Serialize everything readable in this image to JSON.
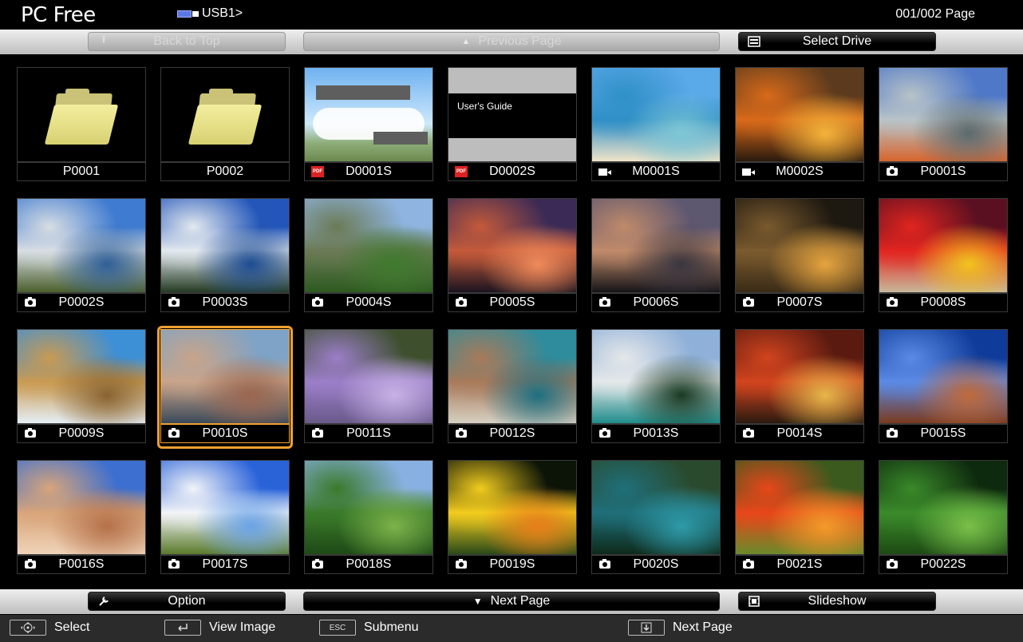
{
  "header": {
    "app_title": "PC Free",
    "drive_label": "USB1>",
    "page_indicator": "001/002 Page"
  },
  "top_bar": {
    "back_to_top": "Back to Top",
    "previous_page": "Previous Page",
    "select_drive": "Select Drive"
  },
  "bottom_bar": {
    "option": "Option",
    "next_page": "Next Page",
    "slideshow": "Slideshow"
  },
  "status_bar": {
    "select": "Select",
    "view_image": "View Image",
    "esc_key": "ESC",
    "submenu": "Submenu",
    "next_page": "Next Page"
  },
  "grid": {
    "items": [
      {
        "label": "P0001",
        "type": "folder"
      },
      {
        "label": "P0002",
        "type": "folder"
      },
      {
        "label": "D0001S",
        "type": "pdf",
        "thumb": "doc1"
      },
      {
        "label": "D0002S",
        "type": "pdf",
        "thumb": "doc2",
        "doc_title": "User's Guide"
      },
      {
        "label": "M0001S",
        "type": "movie",
        "colors": [
          "#5aa9e8",
          "#2f8fc7",
          "#7fc7d6",
          "#f1e4c8"
        ]
      },
      {
        "label": "M0002S",
        "type": "movie",
        "colors": [
          "#5b3a1d",
          "#d86a1a",
          "#f4b43a",
          "#2a1a0e"
        ]
      },
      {
        "label": "P0001S",
        "type": "photo",
        "colors": [
          "#4f78c8",
          "#b8c3c8",
          "#5b6a6e",
          "#d7652d"
        ]
      },
      {
        "label": "P0002S",
        "type": "photo",
        "colors": [
          "#3f7bd0",
          "#d8dde3",
          "#2f5f98",
          "#4b5f2c"
        ]
      },
      {
        "label": "P0003S",
        "type": "photo",
        "colors": [
          "#2356b8",
          "#e3e9ef",
          "#1d4c93",
          "#243a22"
        ]
      },
      {
        "label": "P0004S",
        "type": "photo",
        "colors": [
          "#8fb4e0",
          "#6b7a55",
          "#3f7a2e",
          "#2c5a1f"
        ]
      },
      {
        "label": "P0005S",
        "type": "photo",
        "colors": [
          "#3b2a55",
          "#c45a3a",
          "#f08a5a",
          "#1b1420"
        ]
      },
      {
        "label": "P0006S",
        "type": "photo",
        "colors": [
          "#5e5770",
          "#c08a6a",
          "#3a3640",
          "#151418"
        ]
      },
      {
        "label": "P0007S",
        "type": "photo",
        "colors": [
          "#1d1810",
          "#7a5a2e",
          "#e6a43e",
          "#3a2b17"
        ]
      },
      {
        "label": "P0008S",
        "type": "photo",
        "colors": [
          "#5a1020",
          "#e2251f",
          "#f2c31e",
          "#c8b89a"
        ]
      },
      {
        "label": "P0009S",
        "type": "photo",
        "colors": [
          "#3d8fd6",
          "#c99a52",
          "#8a6430",
          "#e5eef6"
        ]
      },
      {
        "label": "P0010S",
        "type": "photo",
        "selected": true,
        "colors": [
          "#7ea3c6",
          "#c8a48a",
          "#9a6650",
          "#3b4a5a"
        ]
      },
      {
        "label": "P0011S",
        "type": "photo",
        "colors": [
          "#3e4f2e",
          "#9b7ec8",
          "#c7b2e6",
          "#6a5a8a"
        ]
      },
      {
        "label": "P0012S",
        "type": "photo",
        "colors": [
          "#2e8c9c",
          "#a87a5a",
          "#1d6f80",
          "#d7d0c2"
        ]
      },
      {
        "label": "P0013S",
        "type": "photo",
        "colors": [
          "#8fb0d8",
          "#e5e8ea",
          "#1b3a22",
          "#1e8c8a"
        ]
      },
      {
        "label": "P0014S",
        "type": "photo",
        "colors": [
          "#5a1a10",
          "#d2441e",
          "#e8b64a",
          "#2a1a10"
        ]
      },
      {
        "label": "P0015S",
        "type": "photo",
        "colors": [
          "#0f3c9a",
          "#5b8ae6",
          "#c06a3a",
          "#7a3a1e"
        ]
      },
      {
        "label": "P0016S",
        "type": "photo",
        "colors": [
          "#3c6fd0",
          "#d8a57a",
          "#b5714a",
          "#efd3b8"
        ]
      },
      {
        "label": "P0017S",
        "type": "photo",
        "colors": [
          "#2a62d8",
          "#f2f4f8",
          "#6aa3e8",
          "#5a7a2a"
        ]
      },
      {
        "label": "P0018S",
        "type": "photo",
        "colors": [
          "#88b0e0",
          "#3a7a2a",
          "#7cb34a",
          "#1e4a16"
        ]
      },
      {
        "label": "P0019S",
        "type": "photo",
        "colors": [
          "#0c1408",
          "#f2cc1e",
          "#e87e1a",
          "#2a4a18"
        ]
      },
      {
        "label": "P0020S",
        "type": "photo",
        "colors": [
          "#2a4a2e",
          "#1f6f7a",
          "#2e9aa8",
          "#0e2a1a"
        ]
      },
      {
        "label": "P0021S",
        "type": "photo",
        "colors": [
          "#3a5a1e",
          "#e8461a",
          "#f49a2a",
          "#6a8a2a"
        ]
      },
      {
        "label": "P0022S",
        "type": "photo",
        "colors": [
          "#0e2a0e",
          "#3a8a2a",
          "#7ac04a",
          "#1d4a14"
        ]
      }
    ]
  },
  "colors": {
    "selection": "#f0a030",
    "bar_gradient_top": "#efefef",
    "bar_gradient_bottom": "#bdbdbd"
  }
}
